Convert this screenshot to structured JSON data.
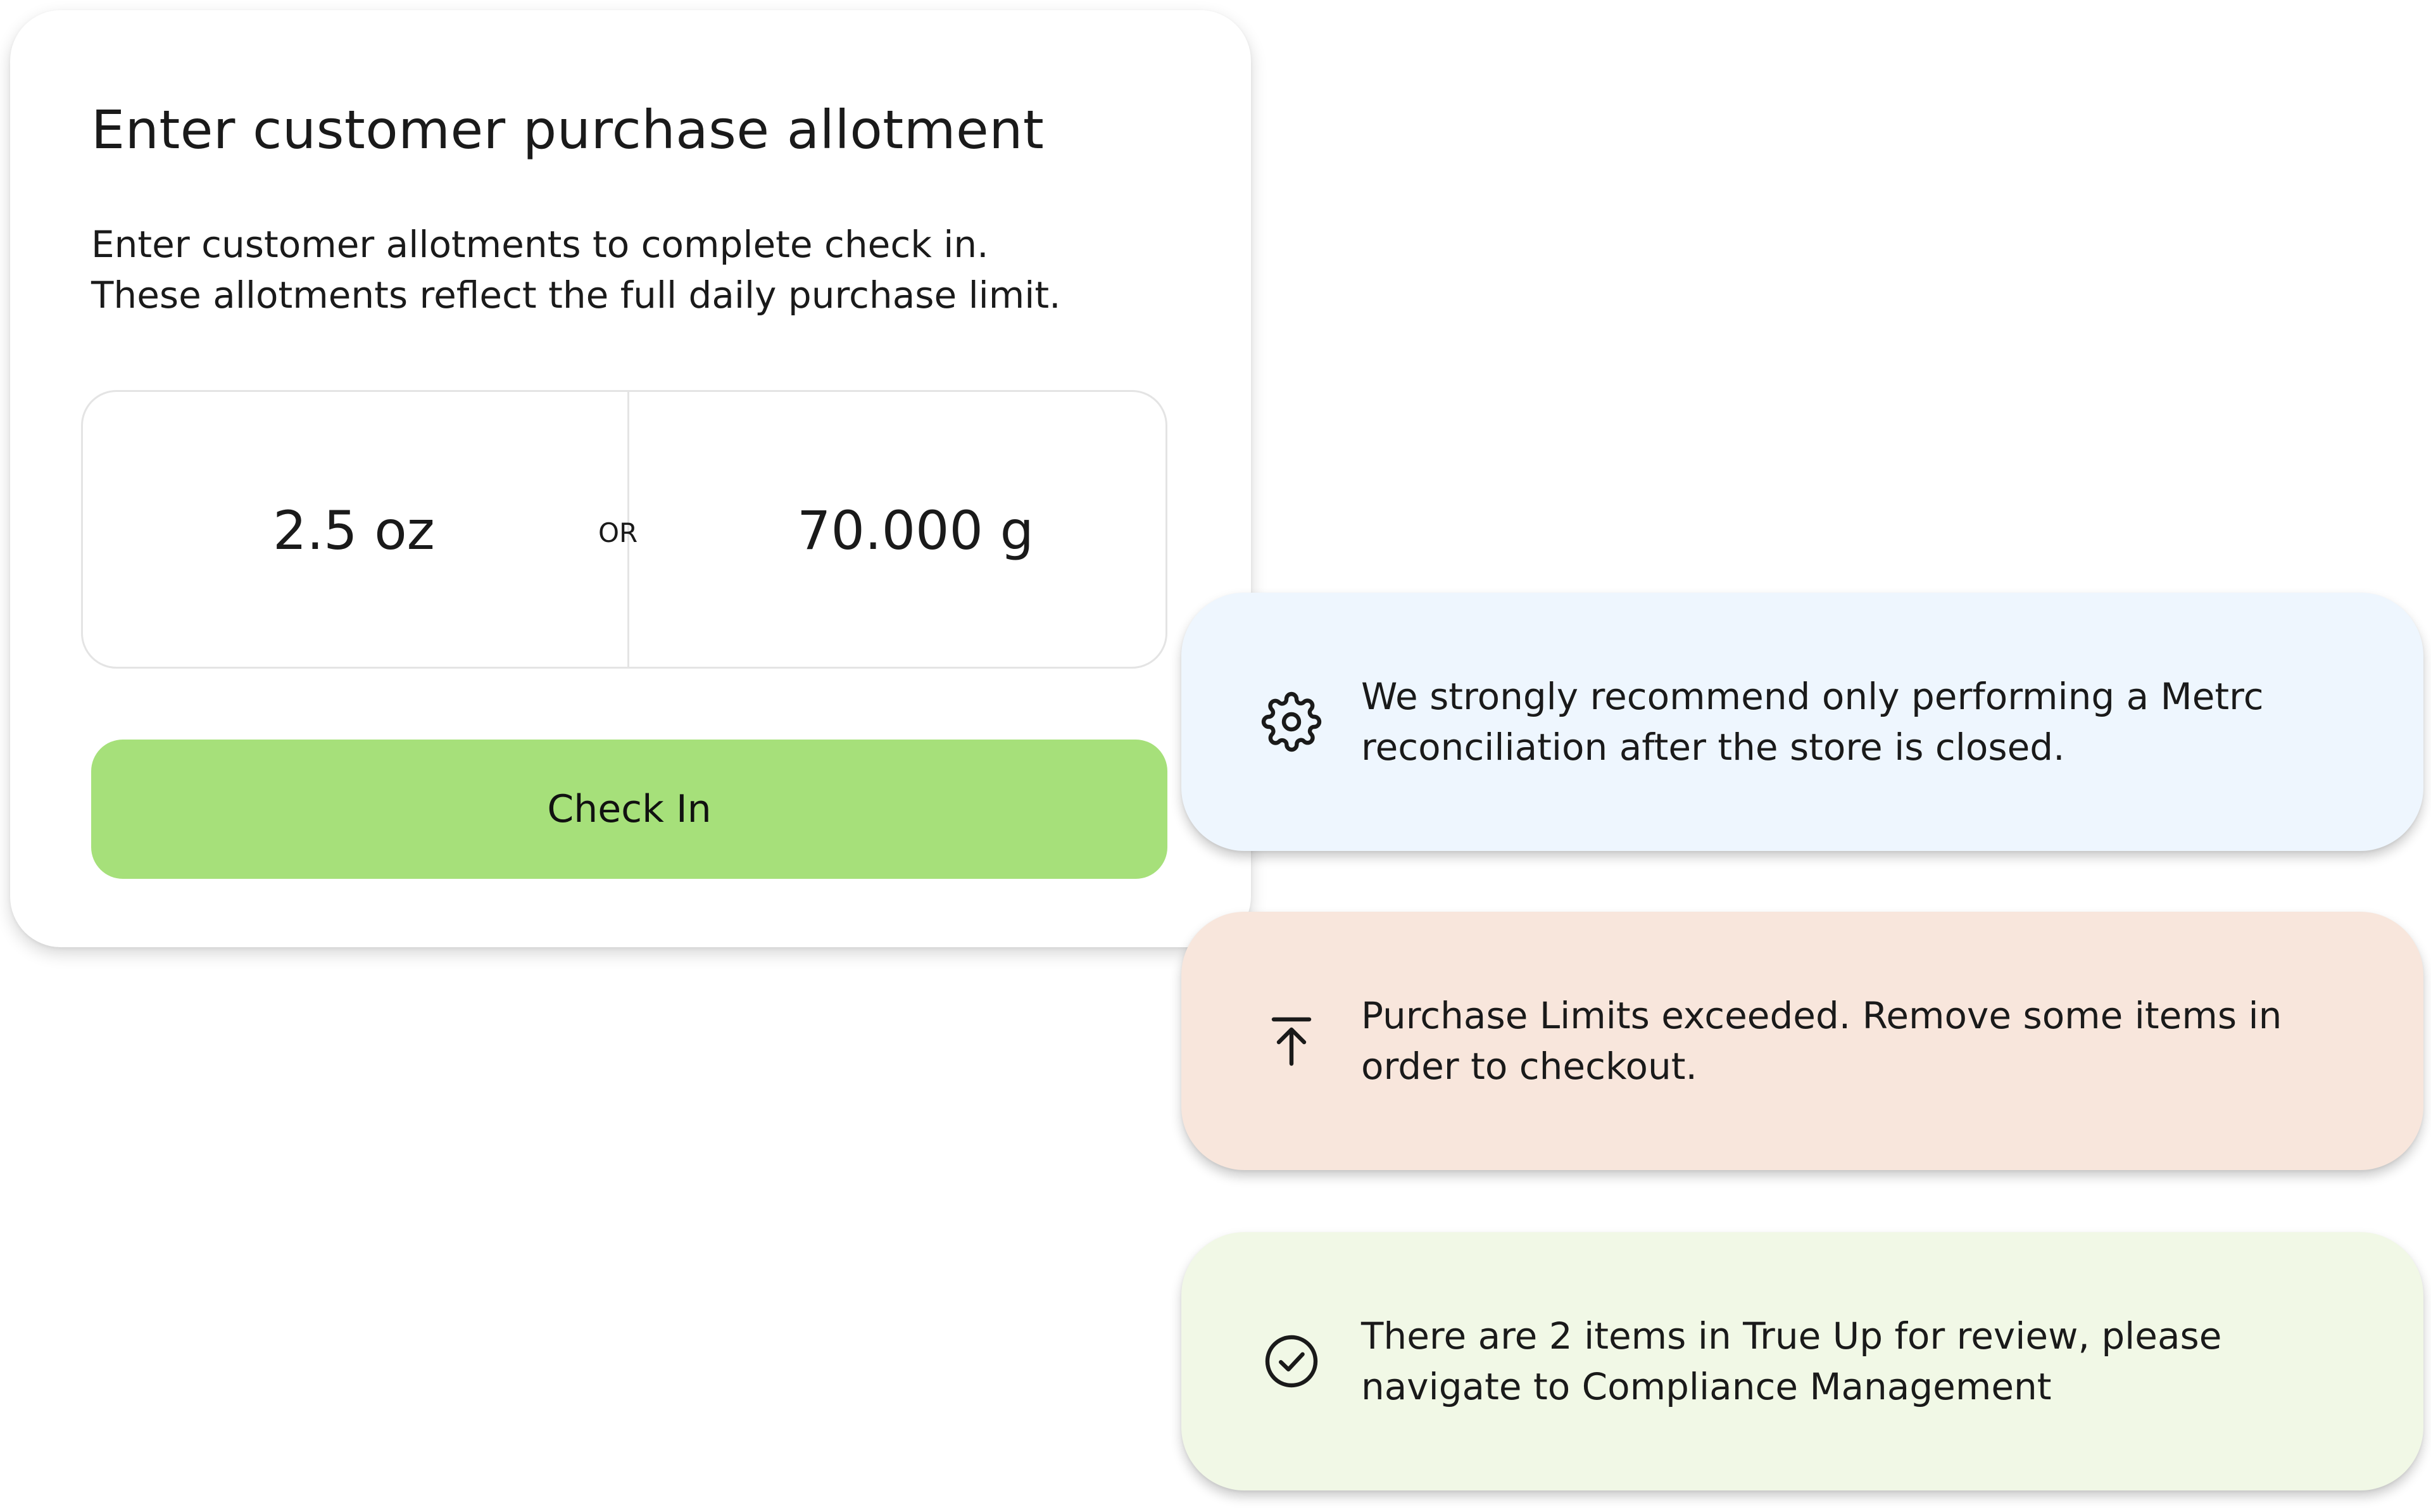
{
  "card": {
    "title": "Enter customer purchase allotment",
    "description_line1": "Enter customer allotments to complete check in.",
    "description_line2": "These allotments reflect the full daily purchase limit.",
    "allotment_oz": "2.5 oz",
    "separator": "OR",
    "allotment_g": "70.000 g",
    "button_label": "Check In",
    "button_color": "#a6e07a"
  },
  "notices": [
    {
      "icon": "gear-icon",
      "line1": "We strongly recommend only performing a Metrc",
      "line2": "reconciliation after the store is closed.",
      "background": "#eef6fe"
    },
    {
      "icon": "arrow-up-to-line-icon",
      "line1": "Purchase Limits exceeded. Remove some items in",
      "line2": "order to checkout.",
      "background": "#f8e6dc"
    },
    {
      "icon": "check-circle-icon",
      "line1": "There are 2 items in True Up for review, please",
      "line2": "navigate to Compliance Management",
      "background": "#f1f8e6"
    }
  ]
}
